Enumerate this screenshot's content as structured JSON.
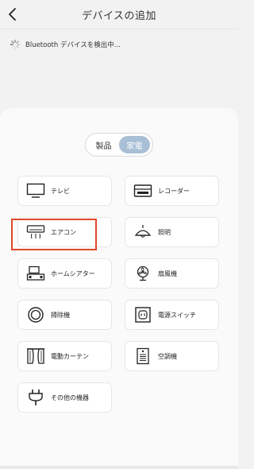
{
  "header": {
    "title": "デバイスの追加"
  },
  "status": {
    "text": "Bluetooth デバイスを検出中..."
  },
  "toggle": {
    "items": [
      "製品",
      "家電"
    ],
    "selected": "家電"
  },
  "devices": [
    {
      "label": "テレビ",
      "icon": "tv-icon"
    },
    {
      "label": "レコーダー",
      "icon": "recorder-icon"
    },
    {
      "label": "エアコン",
      "icon": "air-conditioner-icon"
    },
    {
      "label": "照明",
      "icon": "lamp-icon"
    },
    {
      "label": "ホームシアター",
      "icon": "home-theater-icon"
    },
    {
      "label": "扇風機",
      "icon": "fan-icon"
    },
    {
      "label": "掃除機",
      "icon": "vacuum-icon"
    },
    {
      "label": "電源スイッチ",
      "icon": "power-switch-icon"
    },
    {
      "label": "電動カーテン",
      "icon": "curtain-icon"
    },
    {
      "label": "空調機",
      "icon": "air-purifier-icon"
    },
    {
      "label": "その他の機器",
      "icon": "plug-icon"
    }
  ],
  "colors": {
    "accent": "#a9bfd6",
    "highlight": "#e0482b"
  }
}
